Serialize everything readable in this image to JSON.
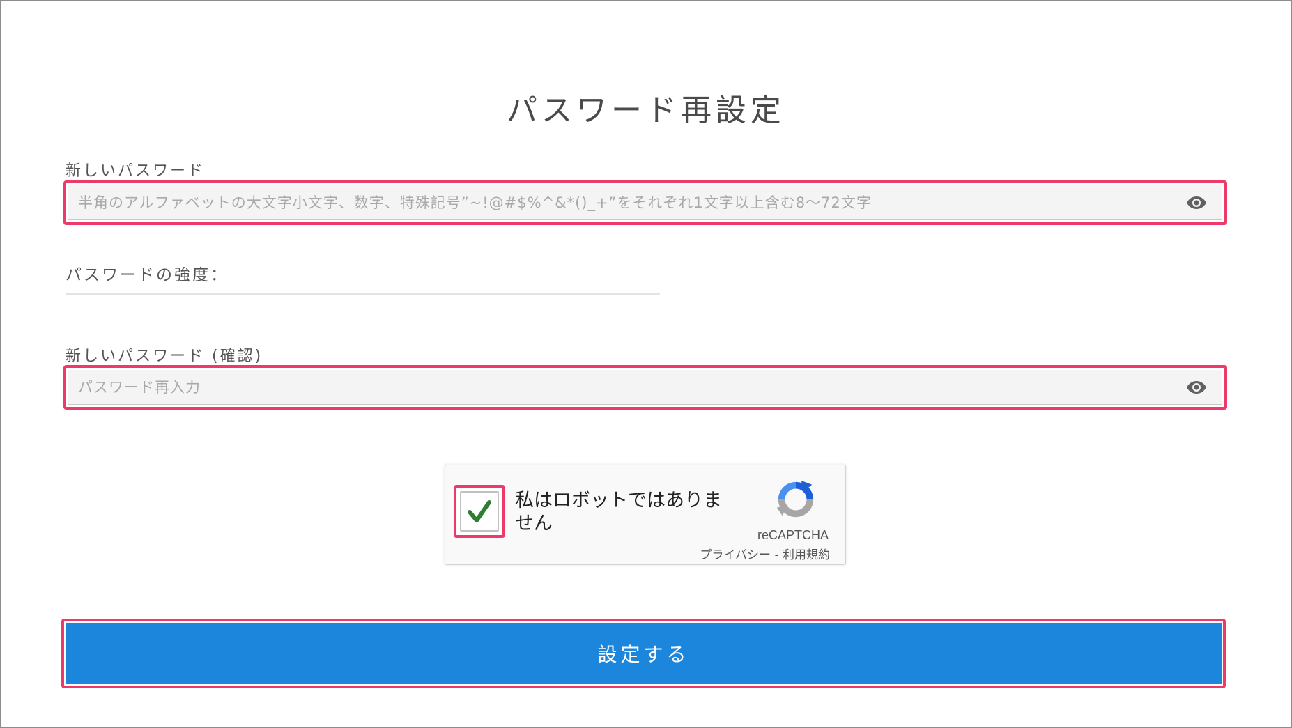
{
  "page": {
    "title": "パスワード再設定"
  },
  "new_password": {
    "label": "新しいパスワード",
    "value": "",
    "placeholder": "半角のアルファベットの大文字小文字、数字、特殊記号”~!@#$%^&*()_+”をそれぞれ1文字以上含む8〜72文字",
    "toggle_icon": "eye-icon"
  },
  "strength": {
    "label": "パスワードの強度：",
    "level": 0
  },
  "confirm_password": {
    "label": "新しいパスワード (確認)",
    "value": "",
    "placeholder": "パスワード再入力",
    "toggle_icon": "eye-icon"
  },
  "recaptcha": {
    "checkbox_label": "私はロボットではありません",
    "checked": true,
    "brand": "reCAPTCHA",
    "privacy_link": "プライバシー",
    "separator": " - ",
    "terms_link": "利用規約",
    "check_icon": "checkmark-icon",
    "logo_icon": "recaptcha-logo-icon"
  },
  "submit": {
    "label": "設定する"
  },
  "colors": {
    "highlight": "#ee3a6a",
    "primary": "#1c86dc",
    "check": "#2e7d32"
  }
}
